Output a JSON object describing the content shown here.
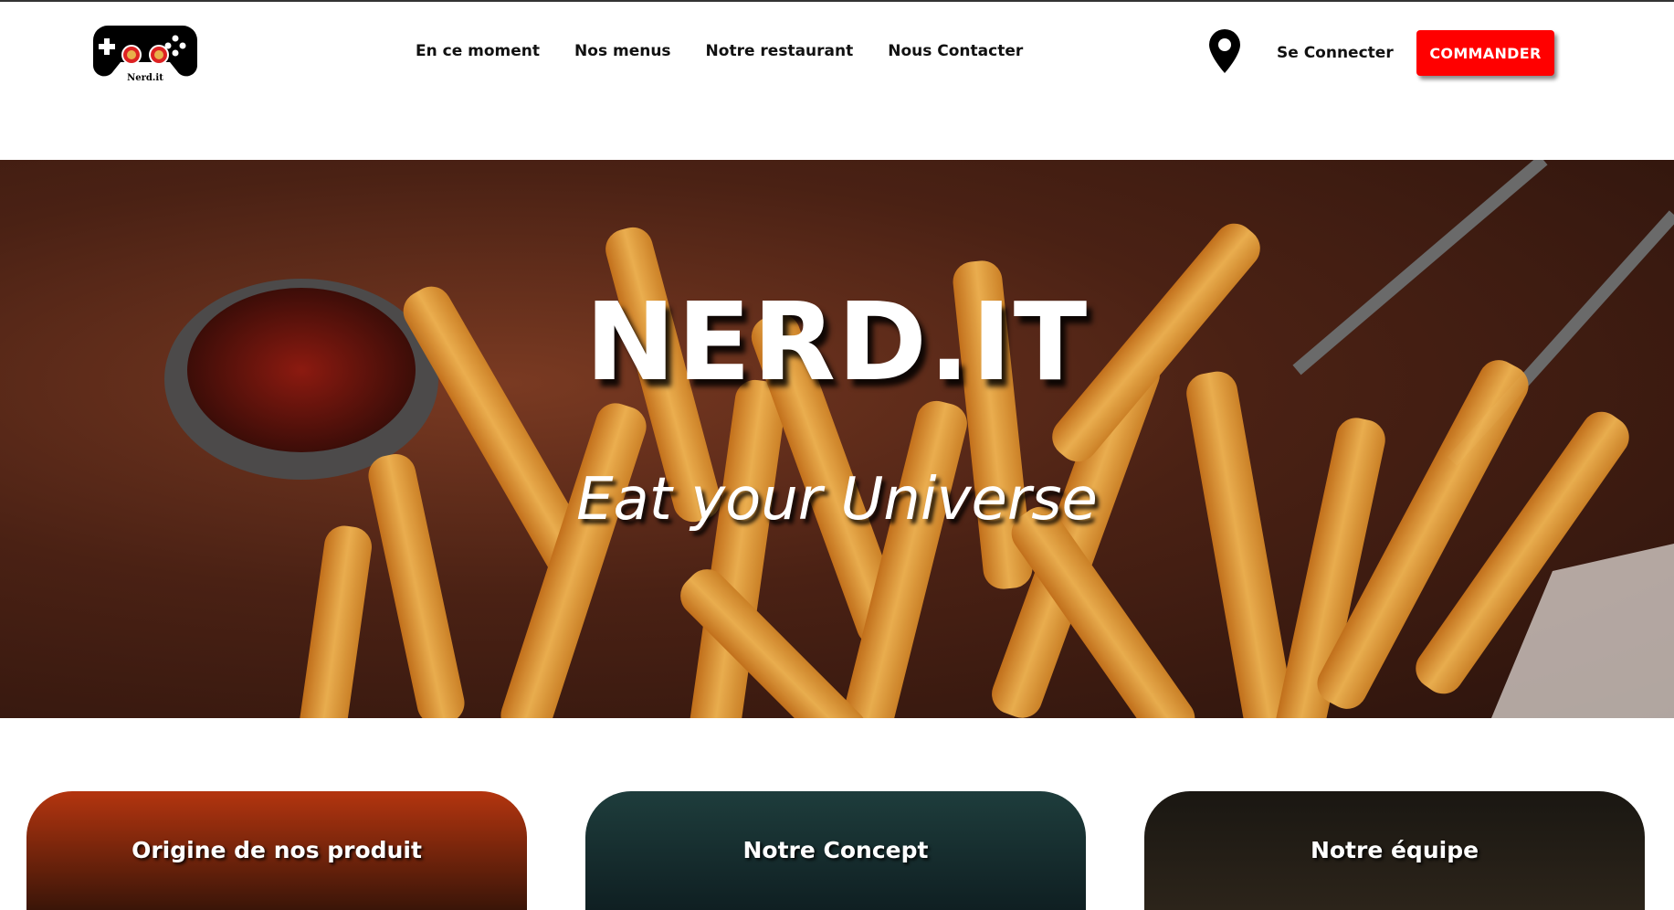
{
  "brand": {
    "logo_text": "Nerd.it"
  },
  "nav": {
    "items": [
      {
        "label": "En ce moment"
      },
      {
        "label": "Nos menus"
      },
      {
        "label": "Notre restaurant"
      },
      {
        "label": "Nous Contacter"
      }
    ]
  },
  "account": {
    "login_label": "Se Connecter",
    "order_label": "COMMANDER"
  },
  "hero": {
    "title": "NERD.IT",
    "subtitle": "Eat your Universe"
  },
  "cards": [
    {
      "title": "Origine de nos produit"
    },
    {
      "title": "Notre Concept"
    },
    {
      "title": "Notre équipe"
    }
  ],
  "colors": {
    "accent": "#ff0000",
    "text": "#111111"
  }
}
